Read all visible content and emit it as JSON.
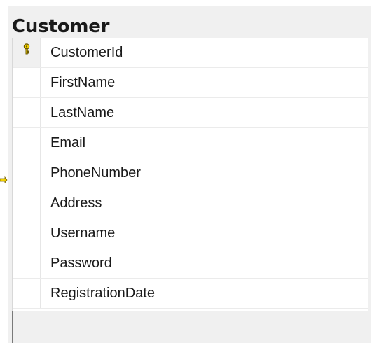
{
  "table": {
    "title": "Customer",
    "columns": [
      {
        "name": "CustomerId",
        "primary_key": true
      },
      {
        "name": "FirstName",
        "primary_key": false
      },
      {
        "name": "LastName",
        "primary_key": false
      },
      {
        "name": "Email",
        "primary_key": false
      },
      {
        "name": "PhoneNumber",
        "primary_key": false
      },
      {
        "name": "Address",
        "primary_key": false
      },
      {
        "name": "Username",
        "primary_key": false
      },
      {
        "name": "Password",
        "primary_key": false
      },
      {
        "name": "RegistrationDate",
        "primary_key": false
      }
    ]
  },
  "icons": {
    "primary_key": "key-icon",
    "relationship": "relationship-connector-icon"
  },
  "colors": {
    "key_icon": "#e8c200",
    "connector": "#f2d000",
    "panel_bg": "#f0f0f0"
  }
}
